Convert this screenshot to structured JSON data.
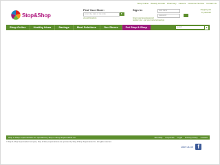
{
  "header": {
    "top_links": [
      "Shop Online",
      "Weekly Circular",
      "Pharmacy",
      "Careers",
      "Customer Service",
      "Contact Us"
    ],
    "logo_text": "Stop&Shop",
    "find_store": {
      "title": "Find Your Store:",
      "placeholder": "enter city, state or zip code",
      "link": "view all locations"
    },
    "sign_in": {
      "title": "Sign In:",
      "user_placeholder": "user name",
      "pass_placeholder": "password",
      "links": [
        "forgot username/password",
        "register now - get your personal savings"
      ]
    },
    "right_links": [
      "shopping list",
      "my account"
    ]
  },
  "main_nav": {
    "tabs": [
      "Shop Online",
      "Healthy Ideas",
      "Savings",
      "Meal Solutions",
      "Our Stores",
      "Pet Stop & Shop"
    ],
    "search_placeholder": "search"
  },
  "footer": {
    "left_text": "Stop & Shop supermarkets are operated by Stop & Shop Supermarket Co.",
    "links": [
      "Site Map",
      "Corporate",
      "Legal",
      "Privacy Policy",
      "Contact"
    ],
    "copyright": "© Stop & Shop Supermarket Company. Stop & Shop supermarkets are operated by Stop & Shop Supermarket Co. All rights reserved.",
    "like_us": "Like us on",
    "facebook_glyph": "f"
  },
  "colors": {
    "brand_green": "#5c8e2c",
    "brand_magenta": "#9a1b7a",
    "facebook_blue": "#3b5998"
  }
}
